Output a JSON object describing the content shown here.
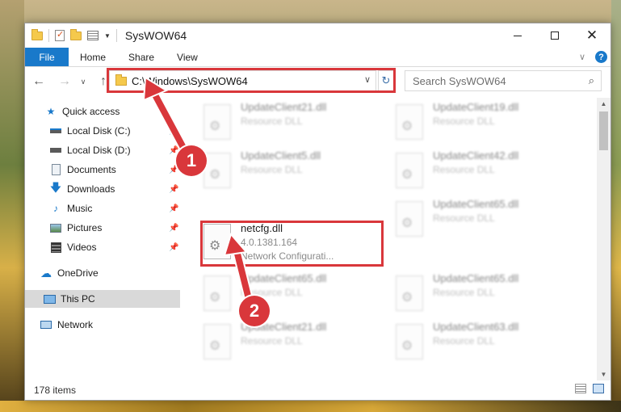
{
  "window": {
    "title": "SysWOW64"
  },
  "ribbon": {
    "tabs": [
      {
        "label": "File"
      },
      {
        "label": "Home"
      },
      {
        "label": "Share"
      },
      {
        "label": "View"
      }
    ]
  },
  "navbar": {
    "address": "C:\\Windows\\SysWOW64",
    "search_placeholder": "Search SysWOW64"
  },
  "sidebar": {
    "items": [
      {
        "label": "Quick access",
        "icon": "star-icon"
      },
      {
        "label": "Local Disk (C:)",
        "icon": "drive-icon"
      },
      {
        "label": "Local Disk (D:)",
        "icon": "drive-icon"
      },
      {
        "label": "Documents",
        "icon": "documents-icon"
      },
      {
        "label": "Downloads",
        "icon": "download-icon"
      },
      {
        "label": "Music",
        "icon": "music-icon"
      },
      {
        "label": "Pictures",
        "icon": "pictures-icon"
      },
      {
        "label": "Videos",
        "icon": "videos-icon"
      },
      {
        "label": "OneDrive",
        "icon": "cloud-icon"
      },
      {
        "label": "This PC",
        "icon": "computer-icon"
      },
      {
        "label": "Network",
        "icon": "network-icon"
      }
    ]
  },
  "files": [
    {
      "name": "UpdateClient21.dll",
      "sub": "Resource DLL",
      "version": ""
    },
    {
      "name": "UpdateClient19.dll",
      "sub": "Resource DLL",
      "version": ""
    },
    {
      "name": "UpdateClient5.dll",
      "sub": "Resource DLL",
      "version": ""
    },
    {
      "name": "UpdateClient42.dll",
      "sub": "Resource DLL",
      "version": ""
    },
    {
      "name": "netcfg.dll",
      "version": "4.0.1381.164",
      "sub": "Network Configurati..."
    },
    {
      "name": "UpdateClient65.dll",
      "sub": "Resource DLL",
      "version": ""
    },
    {
      "name": "UpdateClient65.dll",
      "sub": "Resource DLL",
      "version": ""
    },
    {
      "name": "UpdateClient65.dll",
      "sub": "Resource DLL",
      "version": ""
    },
    {
      "name": "UpdateClient21.dll",
      "sub": "Resource DLL",
      "version": ""
    },
    {
      "name": "UpdateClient63.dll",
      "sub": "Resource DLL",
      "version": ""
    }
  ],
  "status": {
    "item_count": "178 items"
  },
  "callouts": {
    "one": "1",
    "two": "2"
  },
  "colors": {
    "accent": "#1979ca",
    "highlight": "#d9373b",
    "selected_nav": "#d9d9d9"
  }
}
